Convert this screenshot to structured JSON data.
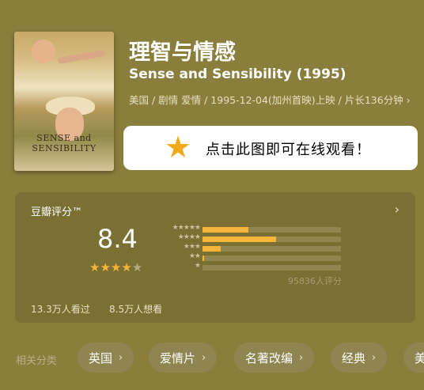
{
  "movie": {
    "title": "理智与情感",
    "original_title": "Sense and Sensibility (1995)",
    "meta": "美国 / 剧情 爱情 / 1995-12-04(加州首映)上映 / 片长136分钟 ›",
    "poster_title": "SENSE and SENSIBILITY"
  },
  "watch_banner": {
    "icon": "star-icon",
    "text": "点击此图即可在线观看！"
  },
  "rating": {
    "label": "豆瓣评分™",
    "score": "8.4",
    "stars_filled": 4,
    "stars_total": 5,
    "distribution": [
      {
        "stars": "★★★★★",
        "fraction": 0.33
      },
      {
        "stars": "★★★★",
        "fraction": 0.53
      },
      {
        "stars": "★★★",
        "fraction": 0.13
      },
      {
        "stars": "★★",
        "fraction": 0.01
      },
      {
        "stars": "★",
        "fraction": 0.0
      }
    ],
    "votes": "95836人评分",
    "watched": "13.3万人看过",
    "wanted": "8.5万人想看",
    "colors": {
      "accent": "#f5b43a",
      "track": "#8f8650"
    }
  },
  "related": {
    "label": "相关分类",
    "tags": [
      {
        "label": "英国"
      },
      {
        "label": "爱情片"
      },
      {
        "label": "名著改编"
      },
      {
        "label": "经典"
      },
      {
        "label": "美"
      }
    ]
  }
}
